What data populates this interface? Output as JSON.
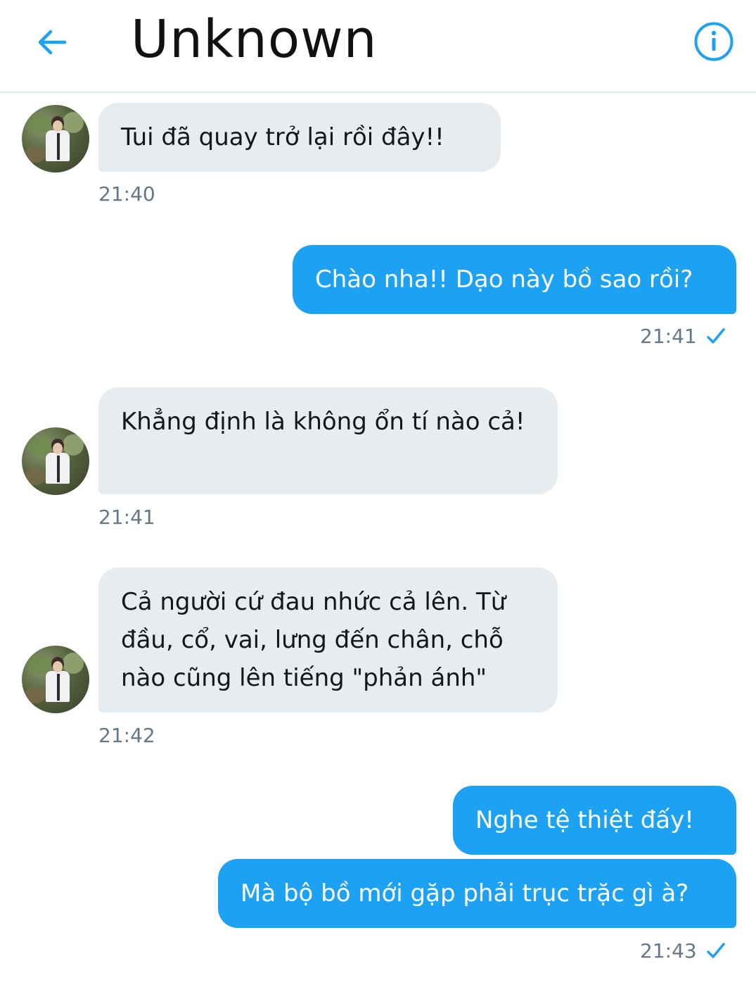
{
  "header": {
    "title": "Unknown",
    "back_icon": "arrow-left-icon",
    "info_icon": "info-circle-icon"
  },
  "colors": {
    "accent": "#1da1f2",
    "incoming_bubble": "#e6ecf0",
    "timestamp": "#657786"
  },
  "messages": [
    {
      "direction": "incoming",
      "text": "Tui đã quay trở lại rồi đây!!",
      "time": "21:40"
    },
    {
      "direction": "outgoing",
      "text": "Chào nha!! Dạo này bồ sao rồi?",
      "time": "21:41",
      "status_icon": "check-icon"
    },
    {
      "direction": "incoming",
      "text": "Khẳng định là không ổn tí nào cả!",
      "time": "21:41"
    },
    {
      "direction": "incoming",
      "text": "Cả người cứ đau nhức cả lên. Từ đầu, cổ, vai, lưng đến chân, chỗ nào cũng lên tiếng \"phản ánh\"",
      "time": "21:42"
    },
    {
      "direction": "outgoing",
      "text": "Nghe tệ thiệt đấy!"
    },
    {
      "direction": "outgoing",
      "text": "Mà bộ bồ mới gặp phải trục trặc gì à?",
      "time": "21:43",
      "status_icon": "check-icon"
    }
  ]
}
